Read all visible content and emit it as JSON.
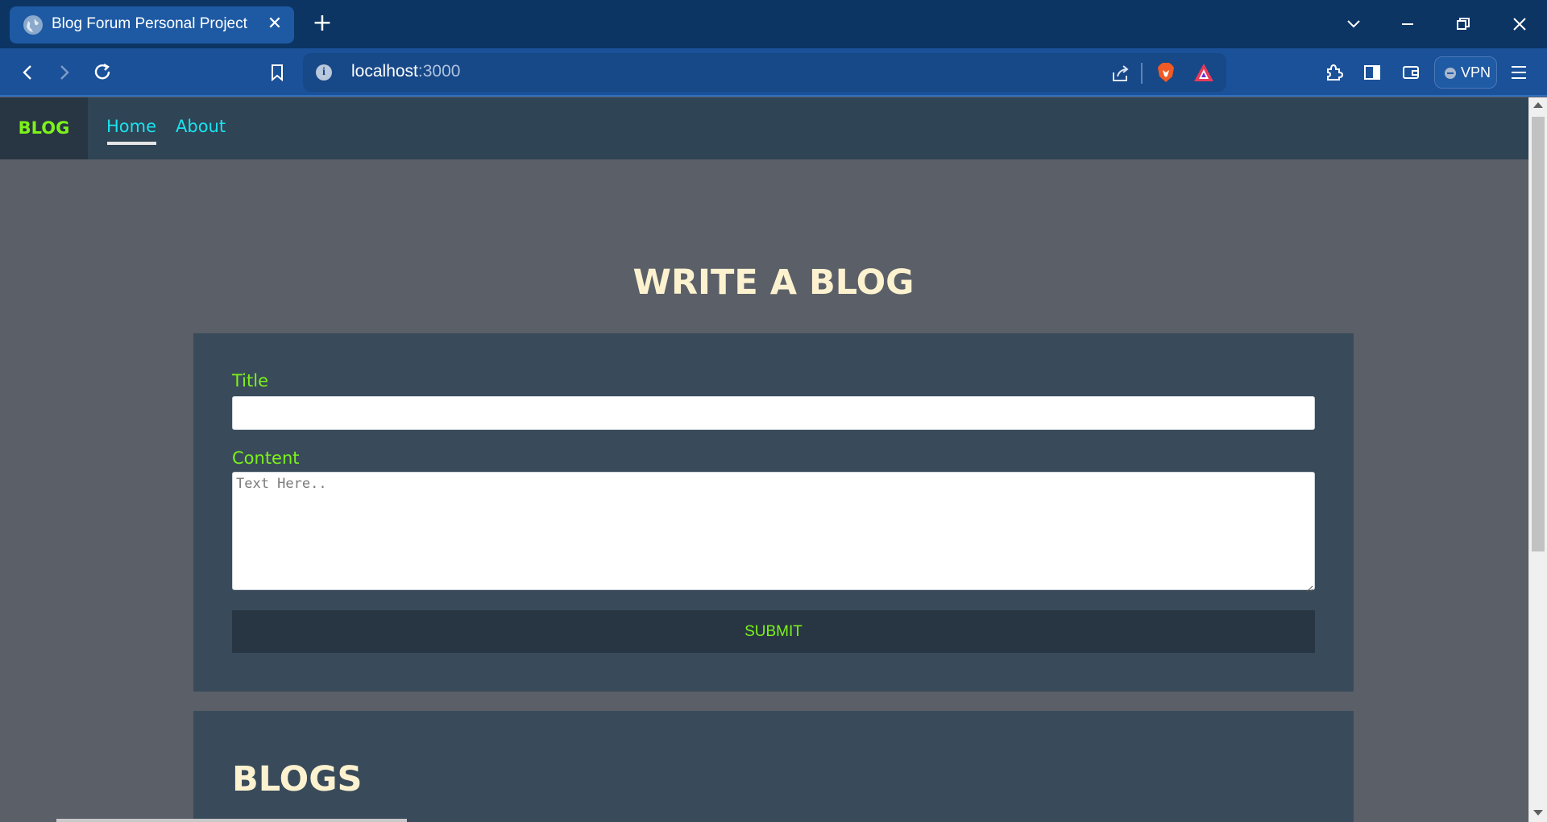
{
  "browser": {
    "tab_title": "Blog Forum Personal Project",
    "tab_close": "✕",
    "new_tab": "+",
    "url_host": "localhost",
    "url_port": ":3000",
    "vpn_label": "VPN"
  },
  "nav": {
    "brand": "BLOG",
    "links": [
      "Home",
      "About"
    ]
  },
  "form": {
    "heading": "WRITE A BLOG",
    "title_label": "Title",
    "title_value": "",
    "content_label": "Content",
    "content_placeholder": "Text Here..",
    "submit_label": "SUBMIT"
  },
  "blogs": {
    "heading": "BLOGS"
  },
  "colors": {
    "accent_green": "#7cf21a",
    "link_cyan": "#19e3ee",
    "heading_cream": "#fdf2cf",
    "navbar": "#2f4455",
    "card": "#394b5a"
  }
}
